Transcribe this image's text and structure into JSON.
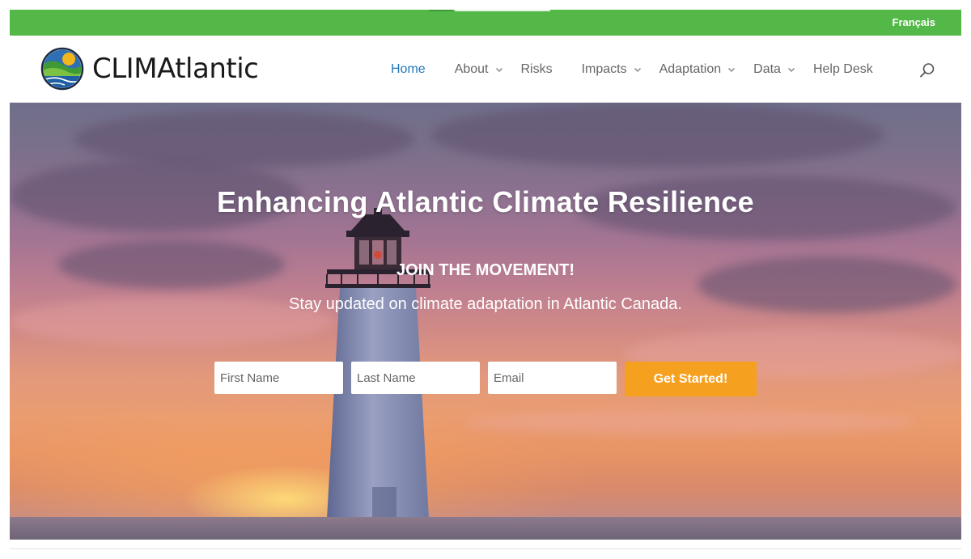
{
  "topbar": {
    "language_link": "Français"
  },
  "brand": {
    "name": "CLIMAtlantic"
  },
  "nav": {
    "items": [
      {
        "label": "Home",
        "active": true,
        "has_submenu": false
      },
      {
        "label": "About",
        "active": false,
        "has_submenu": true
      },
      {
        "label": "Risks",
        "active": false,
        "has_submenu": false
      },
      {
        "label": "Impacts",
        "active": false,
        "has_submenu": true
      },
      {
        "label": "Adaptation",
        "active": false,
        "has_submenu": true
      },
      {
        "label": "Data",
        "active": false,
        "has_submenu": true
      },
      {
        "label": "Help Desk",
        "active": false,
        "has_submenu": false
      }
    ],
    "search_icon": "search-icon"
  },
  "hero": {
    "title": "Enhancing Atlantic Climate Resilience",
    "kicker": "JOIN THE MOVEMENT!",
    "subtitle": "Stay updated on climate adaptation in Atlantic Canada.",
    "form": {
      "first_name_placeholder": "First Name",
      "last_name_placeholder": "Last Name",
      "email_placeholder": "Email",
      "submit_label": "Get Started!"
    },
    "background": "lighthouse-at-sunset-photo"
  },
  "colors": {
    "topbar": "#53b848",
    "nav_active": "#2477b8",
    "nav_text": "#666666",
    "cta": "#f5a01f"
  }
}
